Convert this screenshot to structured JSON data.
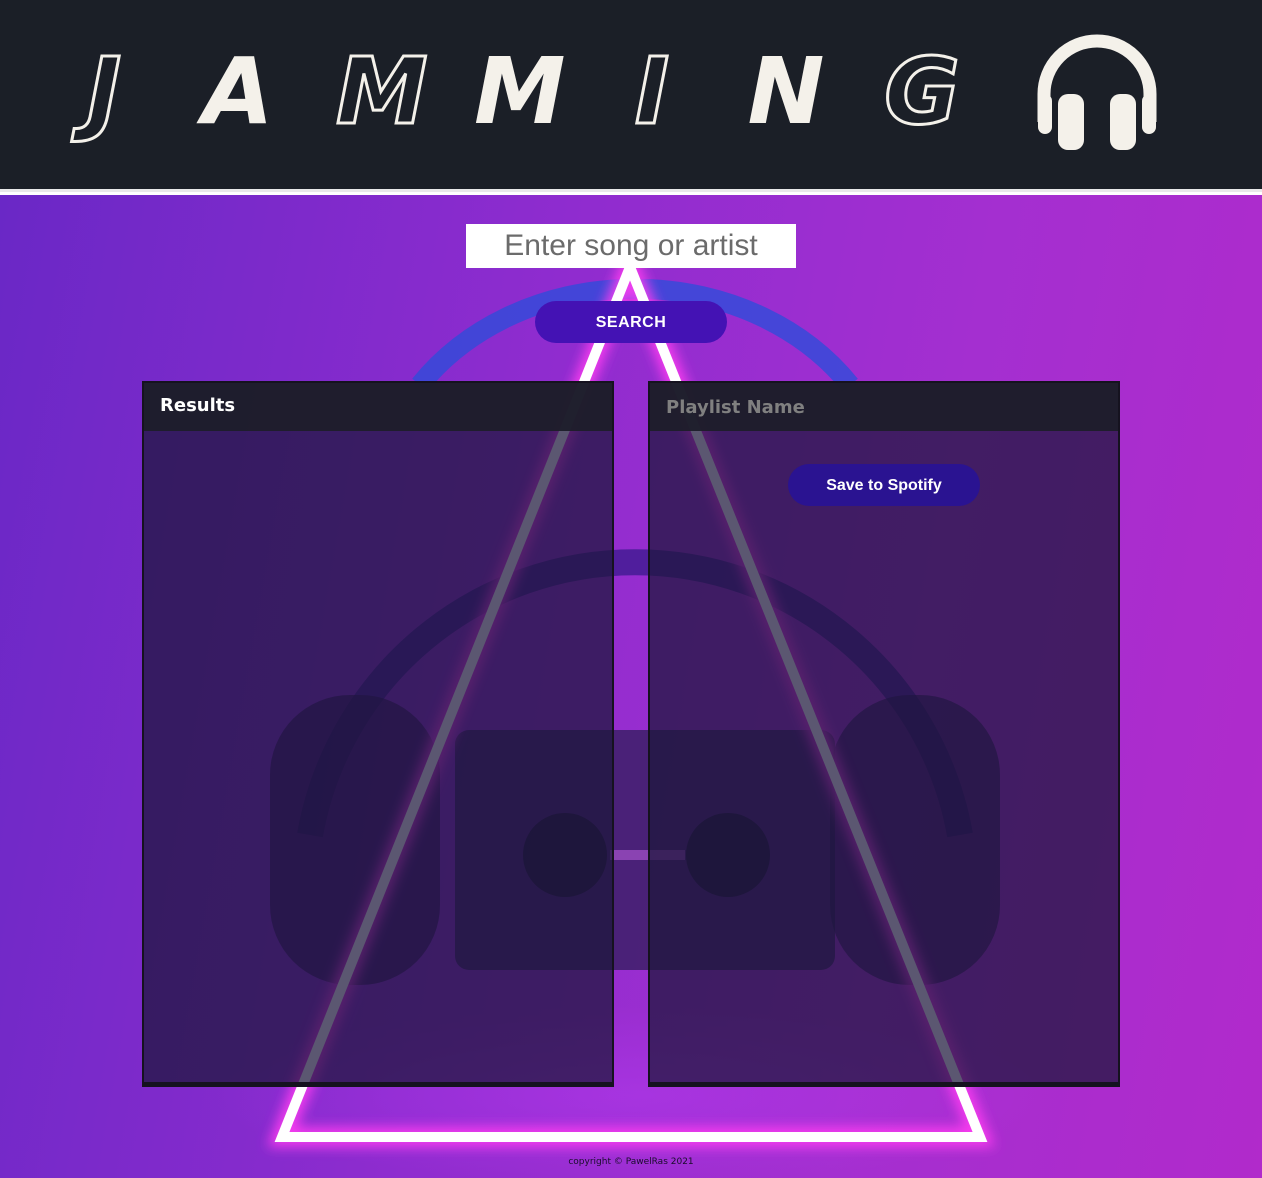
{
  "header": {
    "logo_letters": [
      "J",
      "A",
      "M",
      "M",
      "I",
      "N",
      "G"
    ],
    "logo_icon": "headphones-icon"
  },
  "search": {
    "placeholder": "Enter song or artist",
    "button_label": "SEARCH"
  },
  "results": {
    "title": "Results"
  },
  "playlist": {
    "name_placeholder": "Playlist Name",
    "save_label": "Save to Spotify"
  },
  "footer": {
    "copyright": "copyright © PawelRas 2021"
  },
  "colors": {
    "header_bg": "#1b1f27",
    "accent_button": "#4412b4",
    "save_button": "#2a1391",
    "neon": "#ff4cf7"
  }
}
